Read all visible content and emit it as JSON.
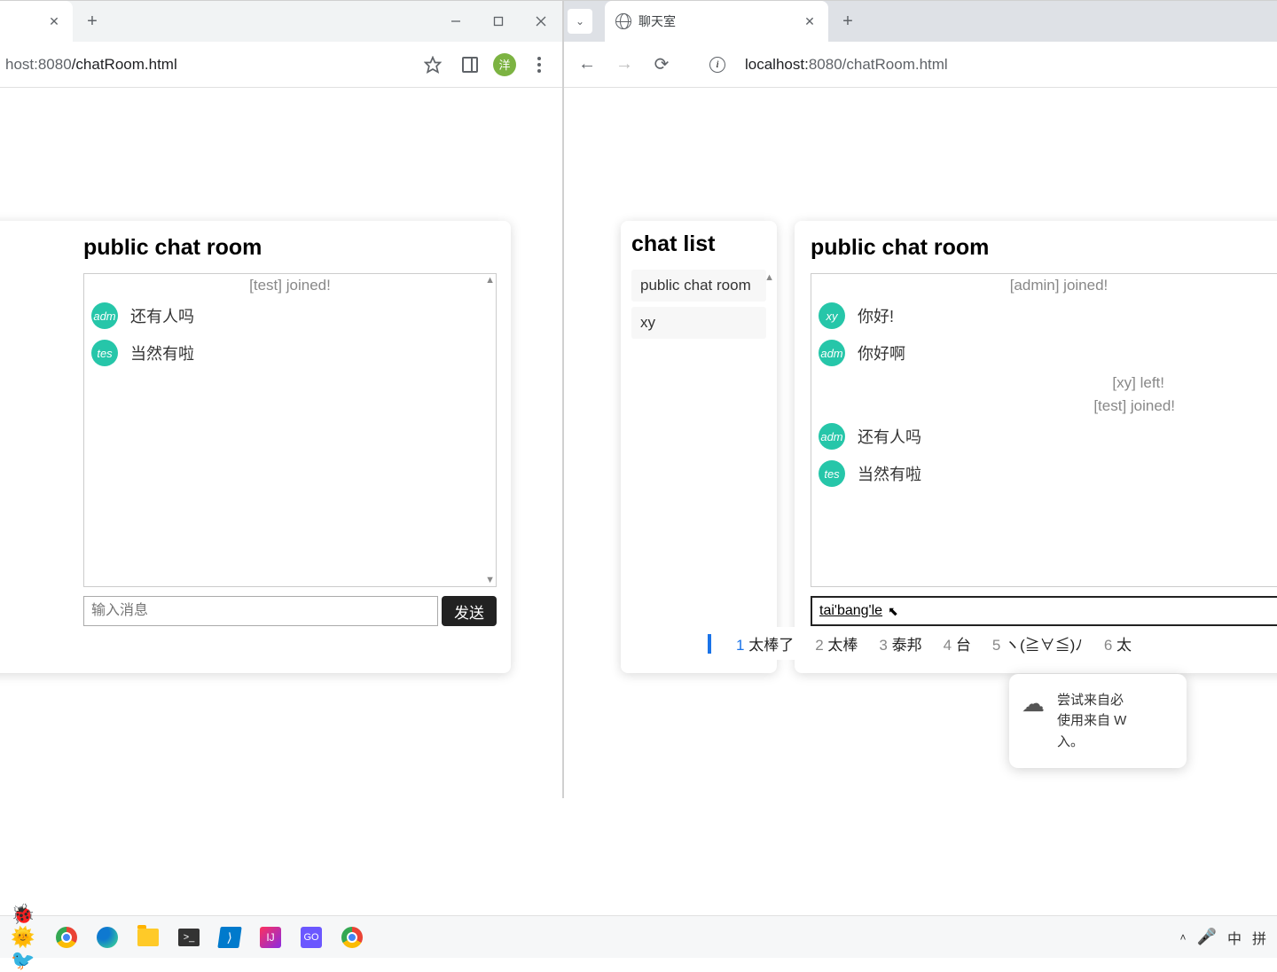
{
  "left_window": {
    "url_partial_prefix": "host:8080",
    "url_partial_suffix": "/chatRoom.html",
    "avatar_letter": "洋",
    "chat_title": "public chat room",
    "messages": [
      {
        "type": "system",
        "text": "[test] joined!"
      },
      {
        "type": "user",
        "avatar": "adm",
        "text": "还有人吗"
      },
      {
        "type": "user",
        "avatar": "tes",
        "text": "当然有啦"
      }
    ],
    "input_placeholder": "输入消息",
    "send_label": "发送"
  },
  "right_window": {
    "tab_title": "聊天室",
    "url_prefix": "localhost:",
    "url_port": "8080",
    "url_suffix": "/chatRoom.html",
    "chat_list_title": "chat list",
    "chat_list_items": [
      "public chat room",
      "xy"
    ],
    "chat_title": "public chat room",
    "messages": [
      {
        "type": "system",
        "text": "[admin] joined!"
      },
      {
        "type": "user",
        "avatar": "xy",
        "text": "你好!"
      },
      {
        "type": "user",
        "avatar": "adm",
        "text": "你好啊"
      },
      {
        "type": "system",
        "text": "[xy] left!"
      },
      {
        "type": "system",
        "text": "[test] joined!"
      },
      {
        "type": "user",
        "avatar": "adm",
        "text": "还有人吗"
      },
      {
        "type": "user",
        "avatar": "tes",
        "text": "当然有啦"
      }
    ],
    "input_value": "tai'bang'le"
  },
  "ime": {
    "candidates": [
      {
        "num": "1",
        "text": "太棒了"
      },
      {
        "num": "2",
        "text": "太棒"
      },
      {
        "num": "3",
        "text": "泰邦"
      },
      {
        "num": "4",
        "text": "台"
      },
      {
        "num": "5",
        "text": "ヽ(≧∀≦)ﾉ"
      },
      {
        "num": "6",
        "text": "太"
      }
    ]
  },
  "bing_popup": {
    "line1": "尝试来自必",
    "line2": "使用来自 W",
    "line3": "入。"
  },
  "taskbar": {
    "lang": "中",
    "ime_mode": "拼"
  }
}
